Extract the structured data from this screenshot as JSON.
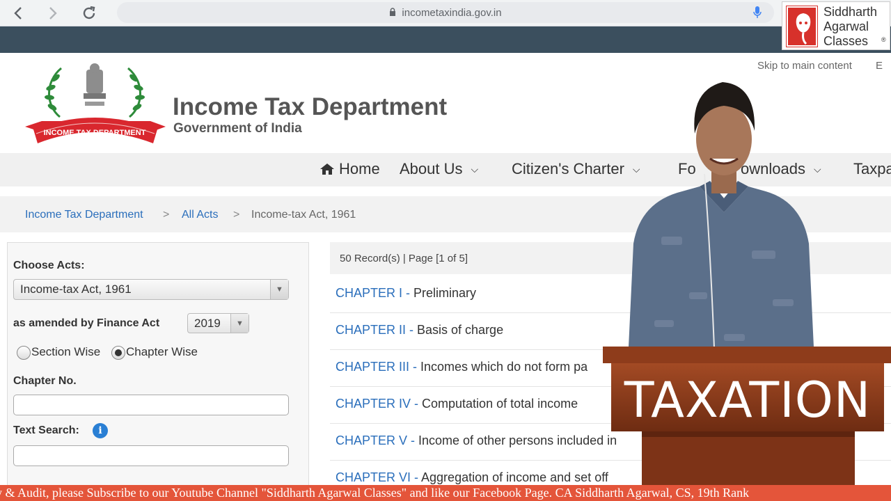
{
  "browser": {
    "url": "incometaxindia.gov.in",
    "back_icon": "back-arrow-icon",
    "forward_icon": "forward-arrow-icon",
    "reload_icon": "reload-icon"
  },
  "header": {
    "skip_link": "Skip to main content",
    "skip_sep": "E",
    "title": "Income Tax Department",
    "subtitle": "Government of India",
    "logo_text": "INCOME TAX DEPARTMENT"
  },
  "menu": {
    "items": [
      {
        "label": "Home",
        "icon": "home-icon"
      },
      {
        "label": "About Us"
      },
      {
        "label": "Citizen's Charter"
      },
      {
        "label": "Fo"
      },
      {
        "label": "ownloads"
      },
      {
        "label": "Taxpa"
      }
    ]
  },
  "breadcrumb": {
    "items": [
      "Income Tax Department",
      "All Acts",
      "Income-tax Act, 1961"
    ],
    "separator": ">"
  },
  "filters": {
    "choose_acts_label": "Choose Acts:",
    "act_selected": "Income-tax Act, 1961",
    "amended_label": "as amended by Finance Act",
    "year_selected": "2019",
    "radio_section": "Section Wise",
    "radio_chapter": "Chapter Wise",
    "chapter_no_label": "Chapter No.",
    "chapter_no_value": "",
    "text_search_label": "Text Search:",
    "text_search_value": ""
  },
  "results": {
    "summary": "50 Record(s) | Page [1 of 5]",
    "chapters": [
      {
        "num": "CHAPTER I - ",
        "title": "Preliminary"
      },
      {
        "num": "CHAPTER II - ",
        "title": "Basis of charge"
      },
      {
        "num": "CHAPTER III - ",
        "title": "Incomes which do not form pa"
      },
      {
        "num": "CHAPTER IV - ",
        "title": "Computation of total income"
      },
      {
        "num": "CHAPTER V - ",
        "title": "Income of other persons included in"
      },
      {
        "num": "CHAPTER VI - ",
        "title": "Aggregation of income and set off"
      }
    ]
  },
  "overlay": {
    "podium_text": "TAXATION",
    "brand_lines": [
      "Siddharth",
      "Agarwal",
      "Classes"
    ],
    "brand_mark": "®",
    "ticker": "y & Audit, please Subscribe to our Youtube Channel \"Siddharth Agarwal Classes\" and like our Facebook Page. CA Siddharth Agarwal, CS, 19th Rank"
  },
  "colors": {
    "link": "#2a6ebb",
    "topbar": "#3b4f5e",
    "ticker_bg": "#e4553a",
    "podium": "#8a3d1e"
  }
}
